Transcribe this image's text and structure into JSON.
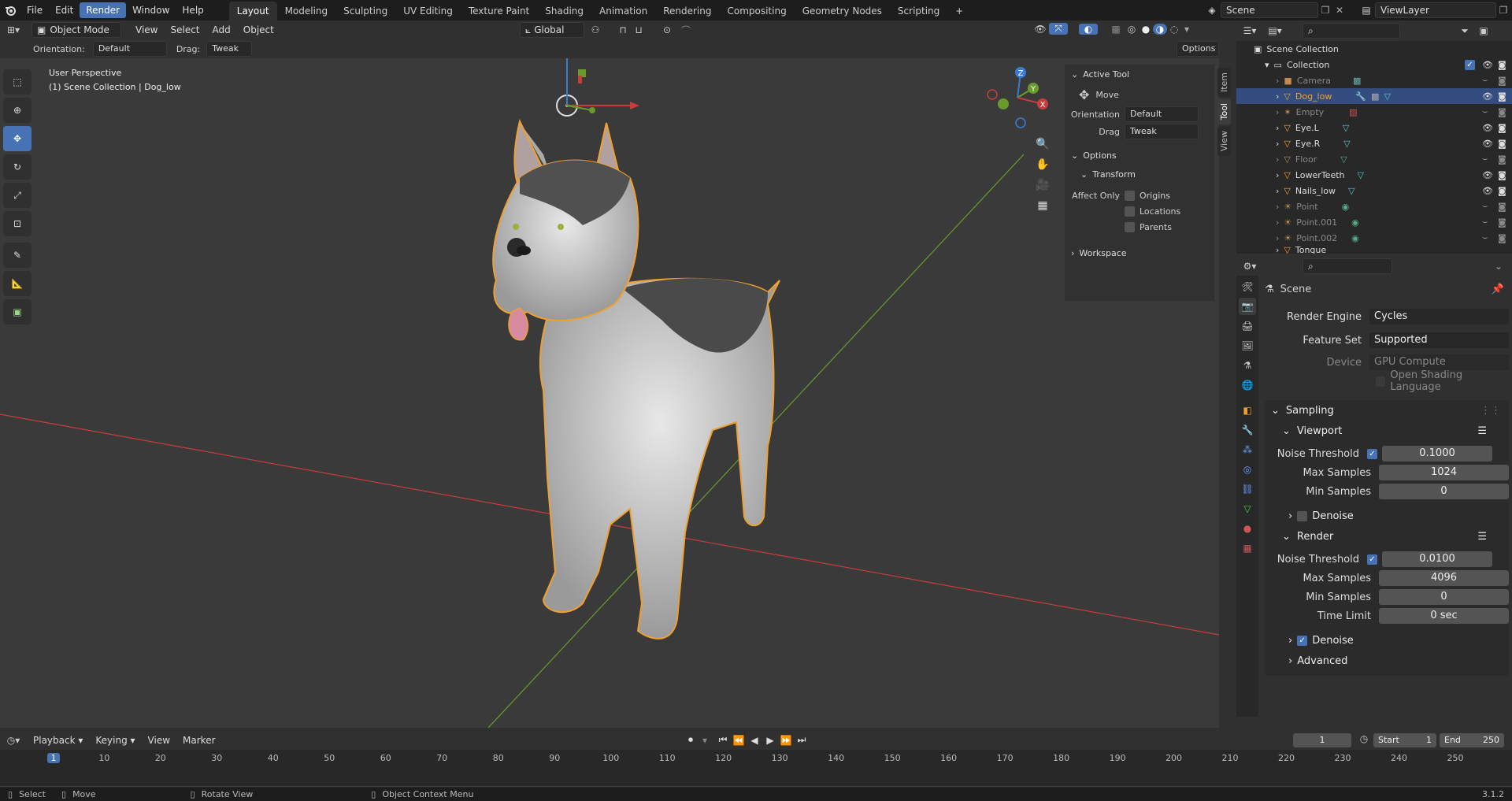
{
  "menus": {
    "file": "File",
    "edit": "Edit",
    "render": "Render",
    "window": "Window",
    "help": "Help"
  },
  "workspaces": [
    "Layout",
    "Modeling",
    "Sculpting",
    "UV Editing",
    "Texture Paint",
    "Shading",
    "Animation",
    "Rendering",
    "Compositing",
    "Geometry Nodes",
    "Scripting"
  ],
  "scene_name": "Scene",
  "view_layer": "ViewLayer",
  "viewport": {
    "mode": "Object Mode",
    "menu": {
      "view": "View",
      "select": "Select",
      "add": "Add",
      "object": "Object"
    },
    "transform_orientation": "Global",
    "tool_header": {
      "orientation_label": "Orientation:",
      "orientation_value": "Default",
      "drag_label": "Drag:",
      "drag_value": "Tweak",
      "options": "Options"
    },
    "overlay_text": {
      "perspective": "User Perspective",
      "collection": "(1) Scene Collection | Dog_low"
    },
    "gizmo": {
      "x": "X",
      "y": "Y",
      "z": "Z"
    }
  },
  "npanel": {
    "active_tool": "Active Tool",
    "tool_name": "Move",
    "orientation_label": "Orientation",
    "orientation_value": "Default",
    "drag_label": "Drag",
    "drag_value": "Tweak",
    "options": "Options",
    "transform": "Transform",
    "affect_only": "Affect Only",
    "origins": "Origins",
    "locations": "Locations",
    "parents": "Parents",
    "workspace": "Workspace",
    "tabs": {
      "item": "Item",
      "tool": "Tool",
      "view": "View"
    }
  },
  "outliner": {
    "scene_collection": "Scene Collection",
    "collection": "Collection",
    "items": [
      {
        "name": "Camera",
        "dim": true
      },
      {
        "name": "Dog_low",
        "selected": true
      },
      {
        "name": "Empty",
        "dim": true
      },
      {
        "name": "Eye.L"
      },
      {
        "name": "Eye.R"
      },
      {
        "name": "Floor",
        "dim": true
      },
      {
        "name": "LowerTeeth"
      },
      {
        "name": "Nails_low"
      },
      {
        "name": "Point",
        "dim": true
      },
      {
        "name": "Point.001",
        "dim": true
      },
      {
        "name": "Point.002",
        "dim": true
      },
      {
        "name": "Tongue"
      }
    ]
  },
  "properties": {
    "context": "Scene",
    "render_engine_label": "Render Engine",
    "render_engine": "Cycles",
    "feature_set_label": "Feature Set",
    "feature_set": "Supported",
    "device_label": "Device",
    "device": "GPU Compute",
    "osl": "Open Shading Language",
    "sampling": "Sampling",
    "viewport": {
      "title": "Viewport",
      "noise_threshold_label": "Noise Threshold",
      "noise_threshold": "0.1000",
      "max_samples_label": "Max Samples",
      "max_samples": "1024",
      "min_samples_label": "Min Samples",
      "min_samples": "0",
      "denoise": "Denoise"
    },
    "render": {
      "title": "Render",
      "noise_threshold_label": "Noise Threshold",
      "noise_threshold": "0.0100",
      "max_samples_label": "Max Samples",
      "max_samples": "4096",
      "min_samples_label": "Min Samples",
      "min_samples": "0",
      "time_limit_label": "Time Limit",
      "time_limit": "0 sec",
      "denoise": "Denoise"
    },
    "advanced": "Advanced"
  },
  "timeline": {
    "playback": "Playback",
    "keying": "Keying",
    "view": "View",
    "marker": "Marker",
    "current_frame": "1",
    "start_label": "Start",
    "start": "1",
    "end_label": "End",
    "end": "250",
    "ticks": [
      "1",
      "10",
      "20",
      "30",
      "40",
      "50",
      "60",
      "70",
      "80",
      "90",
      "100",
      "110",
      "120",
      "130",
      "140",
      "150",
      "160",
      "170",
      "180",
      "190",
      "200",
      "210",
      "220",
      "230",
      "240",
      "250"
    ]
  },
  "statusbar": {
    "select": "Select",
    "move": "Move",
    "rotate_view": "Rotate View",
    "context_menu": "Object Context Menu",
    "version": "3.1.2"
  },
  "colors": {
    "accent": "#4772b3",
    "selection_outline": "#f0a030",
    "x_axis": "#c83c3c",
    "y_axis": "#6a9a2c",
    "z_axis": "#3a7bd5"
  }
}
